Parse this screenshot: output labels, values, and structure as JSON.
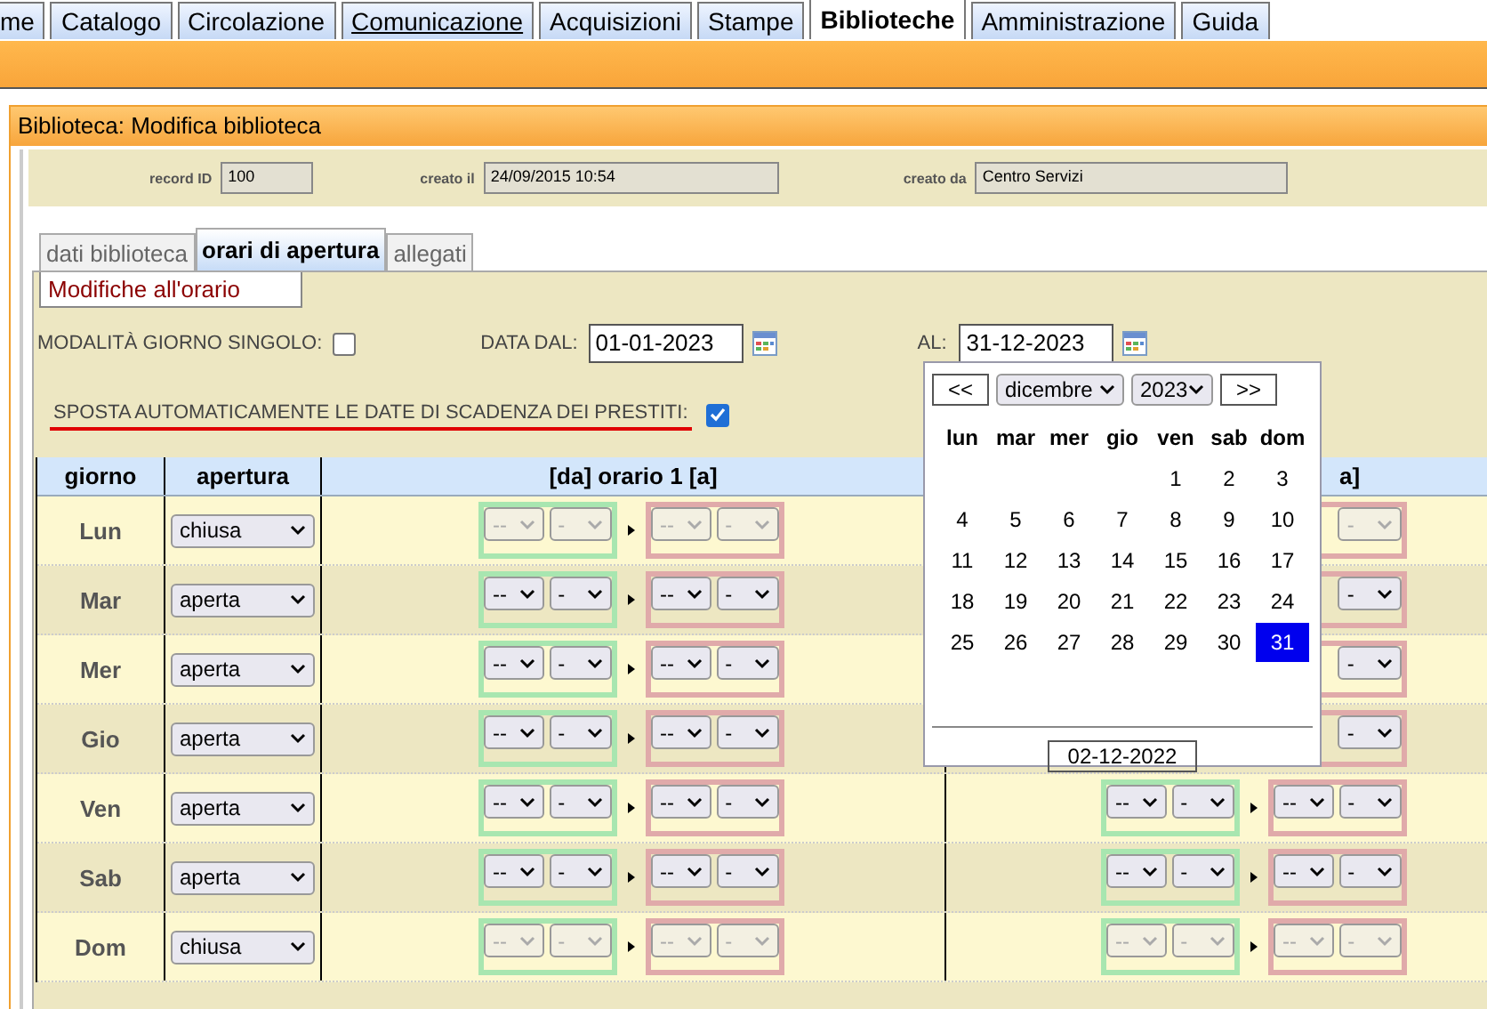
{
  "top_tabs": [
    {
      "label": "me",
      "selected": false,
      "underlined": false
    },
    {
      "label": "Catalogo",
      "selected": false,
      "underlined": false
    },
    {
      "label": "Circolazione",
      "selected": false,
      "underlined": false
    },
    {
      "label": "Comunicazione",
      "selected": false,
      "underlined": true
    },
    {
      "label": "Acquisizioni",
      "selected": false,
      "underlined": false
    },
    {
      "label": "Stampe",
      "selected": false,
      "underlined": false
    },
    {
      "label": "Biblioteche",
      "selected": true,
      "underlined": false
    },
    {
      "label": "Amministrazione",
      "selected": false,
      "underlined": false
    },
    {
      "label": "Guida",
      "selected": false,
      "underlined": false
    }
  ],
  "panel": {
    "title": "Biblioteca: Modifica biblioteca"
  },
  "record": [
    {
      "label": "record ID",
      "value": "100"
    },
    {
      "label": "creato il",
      "value": "24/09/2015 10:54"
    },
    {
      "label": "creato da",
      "value": "Centro Servizi"
    }
  ],
  "sub_tabs": [
    {
      "label": "dati biblioteca",
      "selected": false
    },
    {
      "label": "orari di apertura",
      "selected": true
    },
    {
      "label": "allegati",
      "selected": false
    }
  ],
  "section": {
    "legend": "Modifiche all'orario"
  },
  "single_day": {
    "label": "MODALITÀ GIORNO SINGOLO:",
    "checked": false
  },
  "date_from": {
    "label": "DATA DAL:",
    "value": "01-01-2023"
  },
  "date_to": {
    "label": "AL:",
    "value": "31-12-2023"
  },
  "move_due_dates": {
    "label": "SPOSTA AUTOMATICAMENTE LE DATE DI SCADENZA DEI PRESTITI:",
    "checked": true
  },
  "table": {
    "columns": [
      "giorno",
      "apertura",
      "[da] orario 1 [a]",
      "a]"
    ],
    "rows": [
      {
        "day": "Lun",
        "opening": "chiusa",
        "disabled": true,
        "slot_1": {
          "from_hour": "--",
          "from_minute": "-",
          "to_hour": "--",
          "to_minute": "-"
        },
        "slot_2": {
          "to_minute": "-"
        }
      },
      {
        "day": "Mar",
        "opening": "aperta",
        "disabled": false,
        "slot_1": {
          "from_hour": "--",
          "from_minute": "-",
          "to_hour": "--",
          "to_minute": "-"
        },
        "slot_2": {
          "to_minute": "-"
        }
      },
      {
        "day": "Mer",
        "opening": "aperta",
        "disabled": false,
        "slot_1": {
          "from_hour": "--",
          "from_minute": "-",
          "to_hour": "--",
          "to_minute": "-"
        },
        "slot_2": {
          "to_minute": "-"
        }
      },
      {
        "day": "Gio",
        "opening": "aperta",
        "disabled": false,
        "slot_1": {
          "from_hour": "--",
          "from_minute": "-",
          "to_hour": "--",
          "to_minute": "-"
        },
        "slot_2": {
          "to_minute": "-"
        }
      },
      {
        "day": "Ven",
        "opening": "aperta",
        "disabled": false,
        "slot_1": {
          "from_hour": "--",
          "from_minute": "-",
          "to_hour": "--",
          "to_minute": "-"
        },
        "slot_2": {
          "from_hour": "--",
          "from_minute": "-",
          "to_hour": "--",
          "to_minute": "-"
        }
      },
      {
        "day": "Sab",
        "opening": "aperta",
        "disabled": false,
        "slot_1": {
          "from_hour": "--",
          "from_minute": "-",
          "to_hour": "--",
          "to_minute": "-"
        },
        "slot_2": {
          "from_hour": "--",
          "from_minute": "-",
          "to_hour": "--",
          "to_minute": "-"
        }
      },
      {
        "day": "Dom",
        "opening": "chiusa",
        "disabled": true,
        "slot_1": {
          "from_hour": "--",
          "from_minute": "-",
          "to_hour": "--",
          "to_minute": "-"
        },
        "slot_2": {
          "from_hour": "--",
          "from_minute": "-",
          "to_hour": "--",
          "to_minute": "-"
        }
      }
    ]
  },
  "calendar": {
    "prev": "<<",
    "month": "dicembre",
    "year": "2023",
    "next": ">>",
    "weekdays": [
      "lun",
      "mar",
      "mer",
      "gio",
      "ven",
      "sab",
      "dom"
    ],
    "weeks": [
      [
        {
          "label": "1",
          "selected": false
        },
        {
          "label": "2",
          "selected": false
        },
        {
          "label": "3",
          "selected": false
        }
      ],
      [
        {
          "label": "4",
          "selected": false
        },
        {
          "label": "5",
          "selected": false
        },
        {
          "label": "6",
          "selected": false
        },
        {
          "label": "7",
          "selected": false
        },
        {
          "label": "8",
          "selected": false
        },
        {
          "label": "9",
          "selected": false
        },
        {
          "label": "10",
          "selected": false
        }
      ],
      [
        {
          "label": "11",
          "selected": false
        },
        {
          "label": "12",
          "selected": false
        },
        {
          "label": "13",
          "selected": false
        },
        {
          "label": "14",
          "selected": false
        },
        {
          "label": "15",
          "selected": false
        },
        {
          "label": "16",
          "selected": false
        },
        {
          "label": "17",
          "selected": false
        }
      ],
      [
        {
          "label": "18",
          "selected": false
        },
        {
          "label": "19",
          "selected": false
        },
        {
          "label": "20",
          "selected": false
        },
        {
          "label": "21",
          "selected": false
        },
        {
          "label": "22",
          "selected": false
        },
        {
          "label": "23",
          "selected": false
        },
        {
          "label": "24",
          "selected": false
        }
      ],
      [
        {
          "label": "25",
          "selected": false
        },
        {
          "label": "26",
          "selected": false
        },
        {
          "label": "27",
          "selected": false
        },
        {
          "label": "28",
          "selected": false
        },
        {
          "label": "29",
          "selected": false
        },
        {
          "label": "30",
          "selected": false
        },
        {
          "label": "31",
          "selected": true
        }
      ]
    ],
    "today": "02-12-2022"
  }
}
